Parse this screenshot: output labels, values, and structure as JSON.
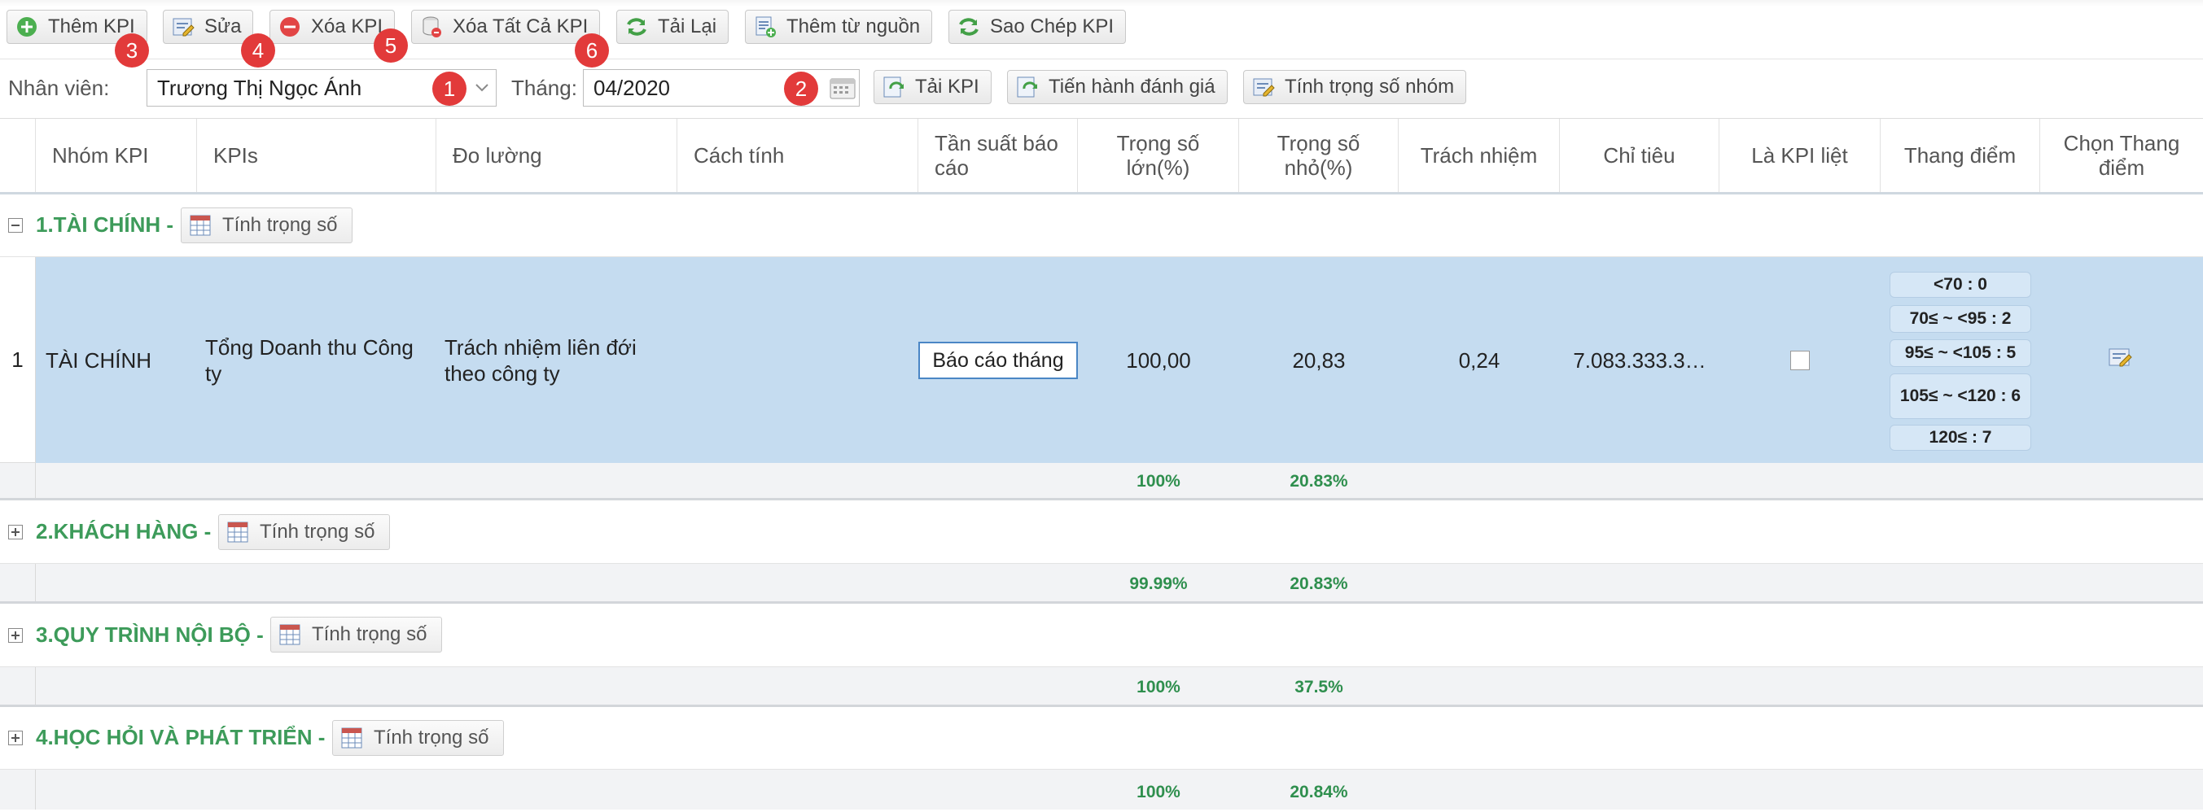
{
  "toolbar": {
    "add_kpi": "Thêm KPI",
    "edit": "Sửa",
    "delete_kpi": "Xóa KPI",
    "delete_all_kpi": "Xóa Tất Cả KPI",
    "reload": "Tải Lại",
    "add_from_source": "Thêm từ nguồn",
    "copy_kpi": "Sao Chép KPI"
  },
  "badges": [
    "1",
    "2",
    "3",
    "4",
    "5",
    "6"
  ],
  "filter": {
    "employee_label": "Nhân viên:",
    "employee_value": "Trương Thị Ngọc Ánh",
    "month_label": "Tháng:",
    "month_value": "04/2020",
    "load_kpi": "Tải KPI",
    "evaluate": "Tiến hành đánh giá",
    "group_weight": "Tính trọng số nhóm"
  },
  "columns": {
    "group": "Nhóm KPI",
    "kpis": "KPIs",
    "measure": "Đo lường",
    "method": "Cách tính",
    "frequency": "Tần suất báo cáo",
    "weight_major": "Trọng số lớn(%)",
    "weight_minor": "Trọng số nhỏ(%)",
    "responsibility": "Trách nhiệm",
    "target": "Chỉ tiêu",
    "is_kpi_list": "Là KPI liệt",
    "scale": "Thang điểm",
    "choose_scale": "Chọn Thang điểm"
  },
  "weight_button_label": "Tính trọng số",
  "groups": [
    {
      "title": "1.TÀI CHÍNH -",
      "sum_major": "100%",
      "sum_minor": "20.83%"
    },
    {
      "title": "2.KHÁCH HÀNG -",
      "sum_major": "99.99%",
      "sum_minor": "20.83%"
    },
    {
      "title": "3.QUY TRÌNH NỘI BỘ -",
      "sum_major": "100%",
      "sum_minor": "37.5%"
    },
    {
      "title": "4.HỌC HỎI VÀ PHÁT TRIỂN -",
      "sum_major": "100%",
      "sum_minor": "20.84%"
    }
  ],
  "row1": {
    "index": "1",
    "group": "TÀI CHÍNH",
    "kpi": "Tổng Doanh thu Công ty",
    "measure": "Trách nhiệm liên đới theo công ty",
    "method": "",
    "frequency": "Báo cáo tháng",
    "weight_major": "100,00",
    "weight_minor": "20,83",
    "responsibility": "0,24",
    "target": "7.083.333.3…",
    "scale": [
      "<70 : 0",
      "70≤ ~ <95 : 2",
      "95≤ ~ <105 : 5",
      "105≤ ~ <120 : 6",
      "120≤ : 7"
    ]
  }
}
